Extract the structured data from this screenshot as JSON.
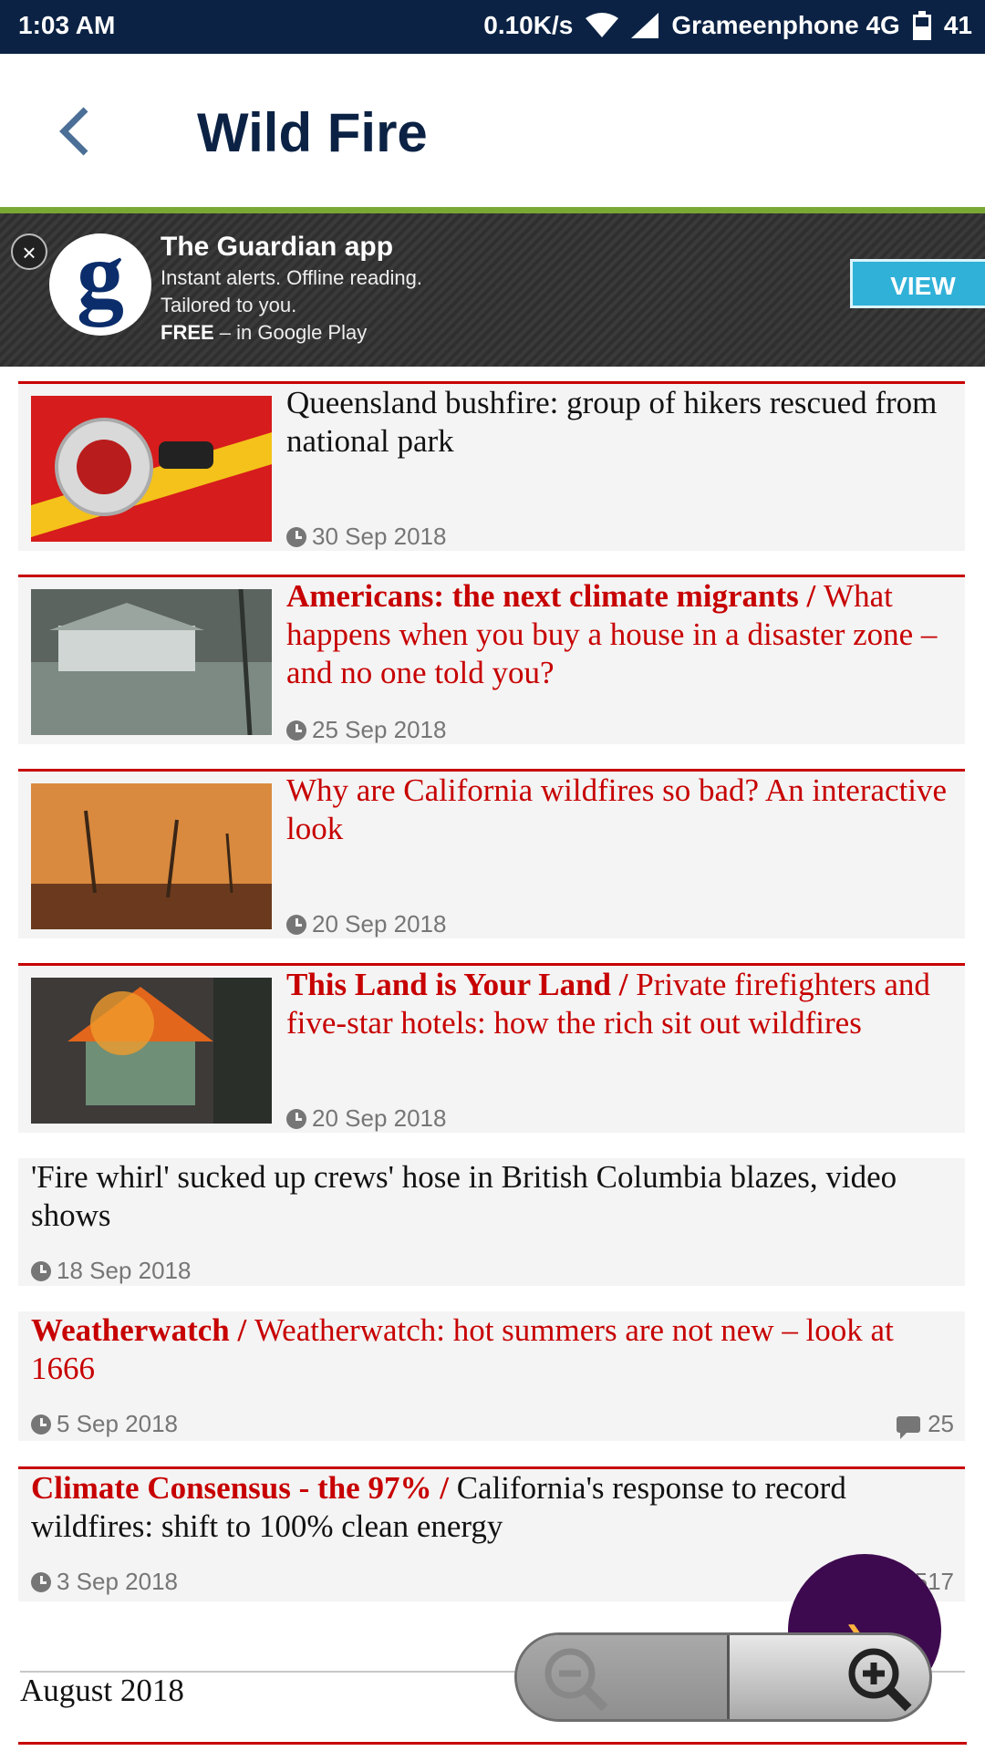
{
  "status_bar": {
    "time": "1:03 AM",
    "speed": "0.10K/s",
    "carrier": "Grameenphone 4G",
    "battery": "41"
  },
  "app_bar": {
    "title": "Wild Fire"
  },
  "banner": {
    "title": "The Guardian app",
    "line1": "Instant alerts. Offline reading.",
    "line2": "Tailored to you.",
    "free": "FREE",
    "line3_rest": " – in Google Play",
    "view_label": "VIEW",
    "close_label": "×",
    "logo_letter": "g"
  },
  "articles": [
    {
      "kicker": "",
      "headline": "Queensland bushfire: group of hikers rescued from national park",
      "date": "30 Sep 2018",
      "comments": ""
    },
    {
      "kicker": "Americans: the next climate migrants / ",
      "headline": "What happens when you buy a house in a disaster zone – and no one told you?",
      "date": "25 Sep 2018",
      "comments": ""
    },
    {
      "kicker": "",
      "headline": "Why are California wildfires so bad? An interactive look",
      "date": "20 Sep 2018",
      "comments": ""
    },
    {
      "kicker": "This Land is Your Land / ",
      "headline": "Private firefighters and five-star hotels: how the rich sit out wildfires",
      "date": "20 Sep 2018",
      "comments": ""
    },
    {
      "kicker": "",
      "headline": "'Fire whirl' sucked up crews' hose in British Columbia blazes, video shows",
      "date": "18 Sep 2018",
      "comments": ""
    },
    {
      "kicker": "Weatherwatch / ",
      "headline": "Weatherwatch: hot summers are not new – look at 1666",
      "date": "5 Sep 2018",
      "comments": "25"
    },
    {
      "kicker": "Climate Consensus - the 97% / ",
      "headline": "California's response to record wildfires: shift to 100% clean energy",
      "date": "3 Sep 2018",
      "comments": "517"
    }
  ],
  "section": {
    "month": "August 2018"
  },
  "fab": {
    "icon": "chevron-right-icon"
  },
  "zoom": {
    "out_icon": "zoom-out-icon",
    "in_icon": "zoom-in-icon"
  },
  "colors": {
    "brand_navy": "#0b2244",
    "accent_red": "#c70000",
    "accent_green": "#7aa834",
    "fab_purple": "#3e0a4f"
  }
}
